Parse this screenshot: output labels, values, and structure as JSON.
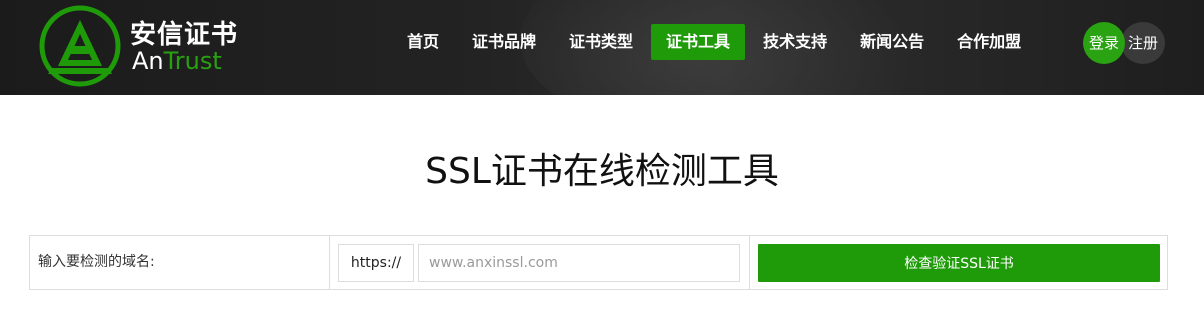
{
  "brand": {
    "name_cn": "安信证书",
    "name_en_part1": "An",
    "name_en_part2": "Trust",
    "accent_color": "#1f9a09",
    "logo_icon": "antrust-logo-icon"
  },
  "nav": {
    "items": [
      {
        "label": "首页"
      },
      {
        "label": "证书品牌"
      },
      {
        "label": "证书类型"
      },
      {
        "label": "证书工具",
        "active": true
      },
      {
        "label": "技术支持"
      },
      {
        "label": "新闻公告"
      },
      {
        "label": "合作加盟"
      }
    ]
  },
  "auth": {
    "login_label": "登录",
    "register_label": "注册"
  },
  "page": {
    "title": "SSL证书在线检测工具"
  },
  "checker": {
    "label": "输入要检测的域名:",
    "protocol": "https://",
    "domain_value": "",
    "domain_placeholder": "www.anxinssl.com",
    "button_label": "检查验证SSL证书"
  }
}
